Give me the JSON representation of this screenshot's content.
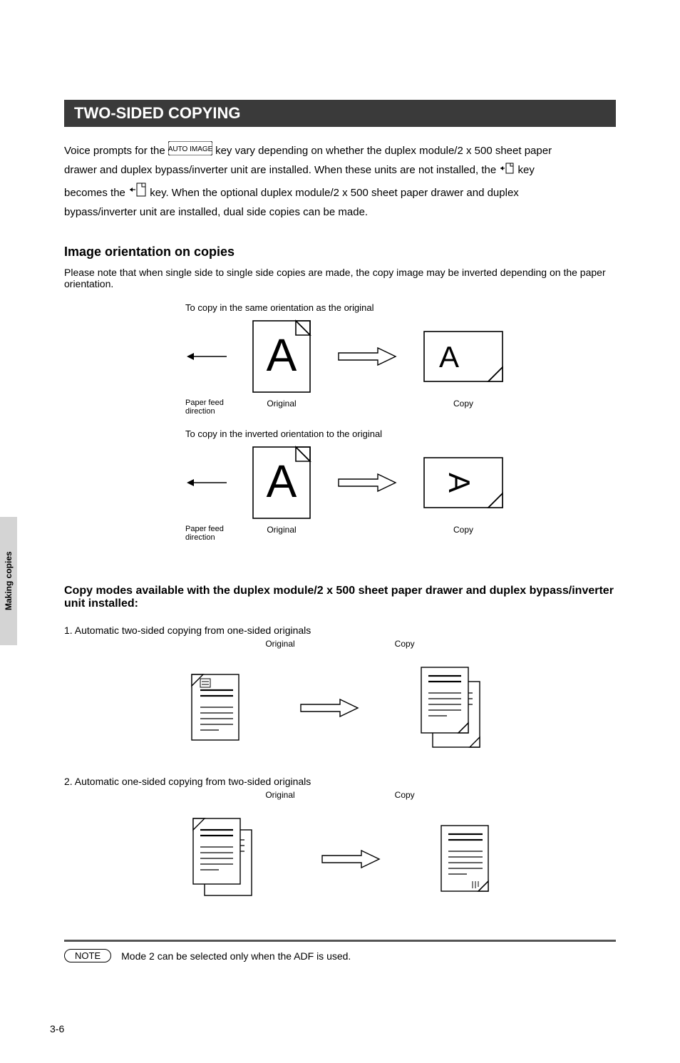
{
  "banner_title": "TWO-SIDED COPYING",
  "intro": {
    "line1_a": "Voice prompts for the ",
    "line1_b": " key vary depending on whether the duplex module/2 x 500 sheet paper",
    "line2_a": "drawer and duplex bypass/inverter unit are installed. When these units are not installed, the ",
    "line2_b": " key",
    "line3_a": "becomes the ",
    "line3_b": " key. When the optional duplex module/2 x 500 sheet paper drawer and duplex",
    "line4": "bypass/inverter unit are installed, dual side copies can be made."
  },
  "sidetab_text": "Making copies",
  "rotation_block": {
    "title": "Image orientation on copies",
    "subtitle": "Please note that when single side to single side copies are made, the copy image may be inverted depending on the paper orientation.",
    "fig1_label": "To copy in the same orientation as the original",
    "fig2_label": "To copy in the inverted orientation to the original",
    "feed_direction_label": "Paper feed direction",
    "original_label": "Original",
    "copy_label": "Copy"
  },
  "modes_block": {
    "title": "Copy modes available with the duplex module/2 x 500 sheet paper drawer and duplex bypass/inverter unit installed:",
    "item1": "1. Automatic two-sided copying from one-sided originals",
    "item1_orig": "Original",
    "item1_copy": "Copy",
    "item2": "2. Automatic one-sided copying from two-sided originals",
    "item2_orig": "Original",
    "item2_copy": "Copy"
  },
  "note_pill": "NOTE",
  "note_text": "Mode 2 can be selected only when the ADF is used.",
  "page_number": "3-6"
}
